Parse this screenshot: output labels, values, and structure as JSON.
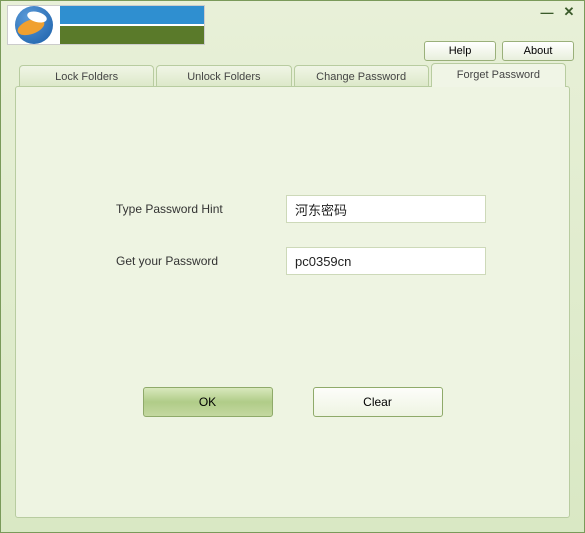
{
  "window": {
    "minimize": "—",
    "close": "✕"
  },
  "header": {
    "help_label": "Help",
    "about_label": "About"
  },
  "tabs": {
    "lock": "Lock Folders",
    "unlock": "Unlock Folders",
    "change": "Change Password",
    "forget": "Forget Password"
  },
  "form": {
    "hint_label": "Type Password Hint",
    "hint_value": "河东密码",
    "get_label": "Get your Password",
    "get_value": "pc0359cn"
  },
  "buttons": {
    "ok": "OK",
    "clear": "Clear"
  }
}
